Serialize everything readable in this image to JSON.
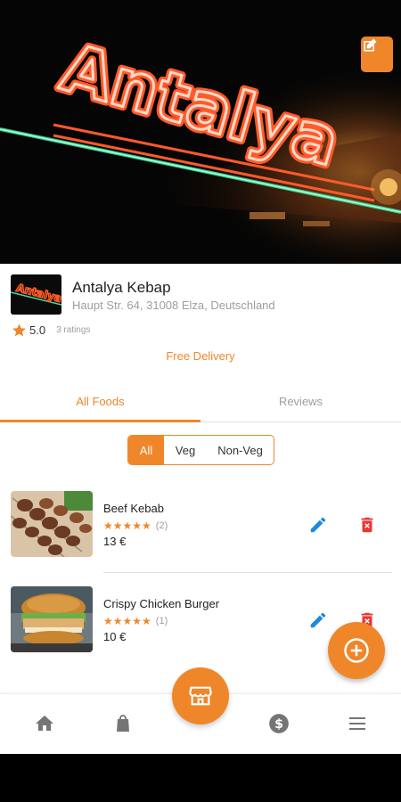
{
  "hero": {
    "sign_text": "Antalya",
    "edit_icon": "edit-square-icon"
  },
  "restaurant": {
    "logo_text": "Antalya",
    "name": "Antalya Kebap",
    "address": "Haupt Str. 64, 31008 Elza, Deutschland",
    "rating": "5.0",
    "ratings_count": "3 ratings",
    "delivery": "Free Delivery"
  },
  "tabs": [
    {
      "label": "All Foods",
      "active": true
    },
    {
      "label": "Reviews",
      "active": false
    }
  ],
  "filter": {
    "options": [
      "All",
      "Veg",
      "Non-Veg"
    ],
    "selected": "All"
  },
  "foods": [
    {
      "name": "Beef Kebab",
      "stars": "★★★★★",
      "rating": 5,
      "reviews": "(2)",
      "price": "13 €"
    },
    {
      "name": "Crispy Chicken Burger",
      "stars": "★★★★★",
      "rating": 5,
      "reviews": "(1)",
      "price": "10 €"
    }
  ],
  "colors": {
    "accent": "#f0862a",
    "edit_blue": "#1e88e5",
    "delete_red": "#e53935",
    "nav_grey": "#757575"
  },
  "nav": {
    "items": [
      "home-icon",
      "shopping-bag-icon",
      "store-icon",
      "dollar-icon",
      "menu-icon"
    ]
  }
}
